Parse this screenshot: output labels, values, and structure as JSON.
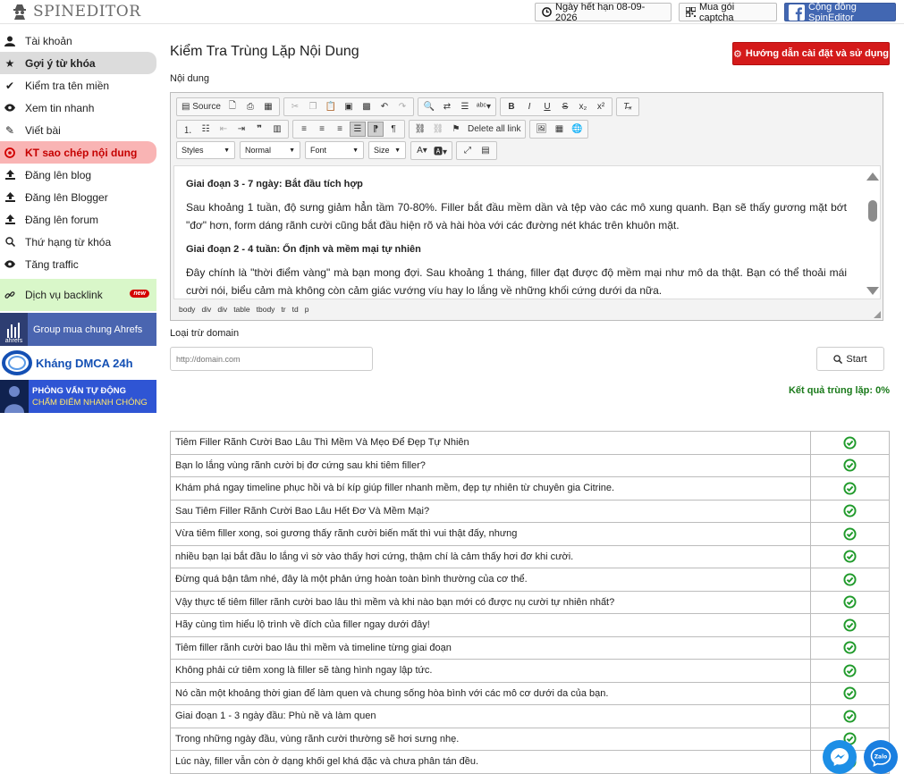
{
  "app": {
    "logo_text": "SPINEDITOR"
  },
  "topbar": {
    "expiry_label": "Ngày hết hạn 08-09-2026",
    "captcha_label": "Mua gói captcha",
    "community_label": "Cộng đồng SpinEditor"
  },
  "sidebar": {
    "items": [
      {
        "label": "Tài khoản",
        "icon": "user-icon"
      },
      {
        "label": "Gợi ý từ khóa",
        "icon": "star-icon"
      },
      {
        "label": "Kiểm tra tên miền",
        "icon": "check-icon"
      },
      {
        "label": "Xem tin nhanh",
        "icon": "eye-icon"
      },
      {
        "label": "Viết bài",
        "icon": "pencil-icon"
      },
      {
        "label": "KT sao chép nội dung",
        "icon": "copyright-icon"
      },
      {
        "label": "Đăng lên blog",
        "icon": "upload-icon"
      },
      {
        "label": "Đăng lên Blogger",
        "icon": "upload-icon"
      },
      {
        "label": "Đăng lên forum",
        "icon": "upload-icon"
      },
      {
        "label": "Thứ hạng từ khóa",
        "icon": "search-icon"
      },
      {
        "label": "Tăng traffic",
        "icon": "eye-icon"
      }
    ],
    "backlink": {
      "label": "Dịch vụ backlink",
      "badge": "new"
    },
    "banners": {
      "ahrefs_logo": "ahrefs",
      "ahrefs": "Group mua chung Ahrefs",
      "dmca": "Kháng DMCA 24h",
      "interview_line1": "PHỎNG VẤN TỰ ĐỘNG",
      "interview_line2": "CHẤM ĐIỂM NHANH CHÓNG"
    }
  },
  "main": {
    "title": "Kiểm Tra Trùng Lặp Nội Dung",
    "guide_button": "Hướng dẫn cài đặt và sử dụng",
    "content_label": "Nội dung",
    "exclude_label": "Loại trừ domain",
    "domain_placeholder": "http://domain.com",
    "start_button": "Start",
    "result": "Kết quả trùng lặp: 0%"
  },
  "editor": {
    "toolbar": {
      "source": "Source",
      "delete_all_link": "Delete all link",
      "styles": "Styles",
      "format": "Normal",
      "font": "Font",
      "size": "Size"
    },
    "content": {
      "h1": "Giai đoạn 3 - 7 ngày: Bắt đầu tích hợp",
      "p1": "Sau khoảng 1 tuần, độ sưng giảm hẳn tầm 70-80%. Filler bắt đầu mềm dần và tệp vào các mô xung quanh. Bạn sẽ thấy gương mặt bớt \"đơ\" hơn, form dáng rãnh cười cũng bắt đầu hiện rõ và hài hòa với các đường nét khác trên khuôn mặt.",
      "h2": "Giai đoạn 2 - 4 tuần: Ổn định và mềm mại tự nhiên",
      "p2": "Đây chính là \"thời điểm vàng\" mà bạn mong đợi. Sau khoảng 1 tháng, filler đạt được độ mềm mại như mô da thật. Bạn có thể thoải mái cười nói, biểu cảm mà không còn cảm giác vướng víu hay lo lắng về những khối cứng dưới da nữa."
    },
    "path": [
      "body",
      "div",
      "div",
      "table",
      "tbody",
      "tr",
      "td",
      "p"
    ]
  },
  "results": [
    "Tiêm Filler Rãnh Cười Bao Lâu Thì Mềm Và Mẹo Để Đẹp Tự Nhiên",
    "Bạn lo lắng vùng rãnh cười bị đơ cứng sau khi tiêm filler?",
    "Khám phá ngay timeline phục hồi và bí kíp giúp filler nhanh mềm, đẹp tự nhiên từ chuyên gia Citrine.",
    "Sau Tiêm Filler Rãnh Cười Bao Lâu Hết Đơ Và Mềm Mại?",
    "Vừa tiêm filler xong, soi gương thấy rãnh cười biến mất thì vui thật đấy, nhưng",
    "nhiều bạn lại bắt đầu lo lắng vì sờ vào thấy hơi cứng, thậm chí là cảm thấy hơi đơ khi cười.",
    "Đừng quá bận tâm nhé, đây là một phản ứng hoàn toàn bình thường của cơ thể.",
    "Vậy thực tế tiêm filler rãnh cười bao lâu thì mềm và khi nào bạn mới có được nụ cười tự nhiên nhất?",
    "Hãy cùng tìm hiểu lộ trình về đích của filler ngay dưới đây!",
    "Tiêm filler rãnh cười bao lâu thì mềm và timeline từng giai đoạn",
    "Không phải cứ tiêm xong là filler sẽ tàng hình ngay lập tức.",
    "Nó cần một khoảng thời gian để làm quen và chung sống hòa bình với các mô cơ dưới da của bạn.",
    "Giai đoạn 1 - 3 ngày đầu: Phù nề và làm quen",
    "Trong những ngày đầu, vùng rãnh cười thường sẽ hơi sưng nhẹ.",
    "Lúc này, filler vẫn còn ở dạng khối gel khá đặc và chưa phân tán đều."
  ],
  "colors": {
    "accent_red": "#d41a1a",
    "check_green": "#1f9a2a",
    "facebook_blue": "#4267b2",
    "result_green": "#1a7a1a"
  }
}
